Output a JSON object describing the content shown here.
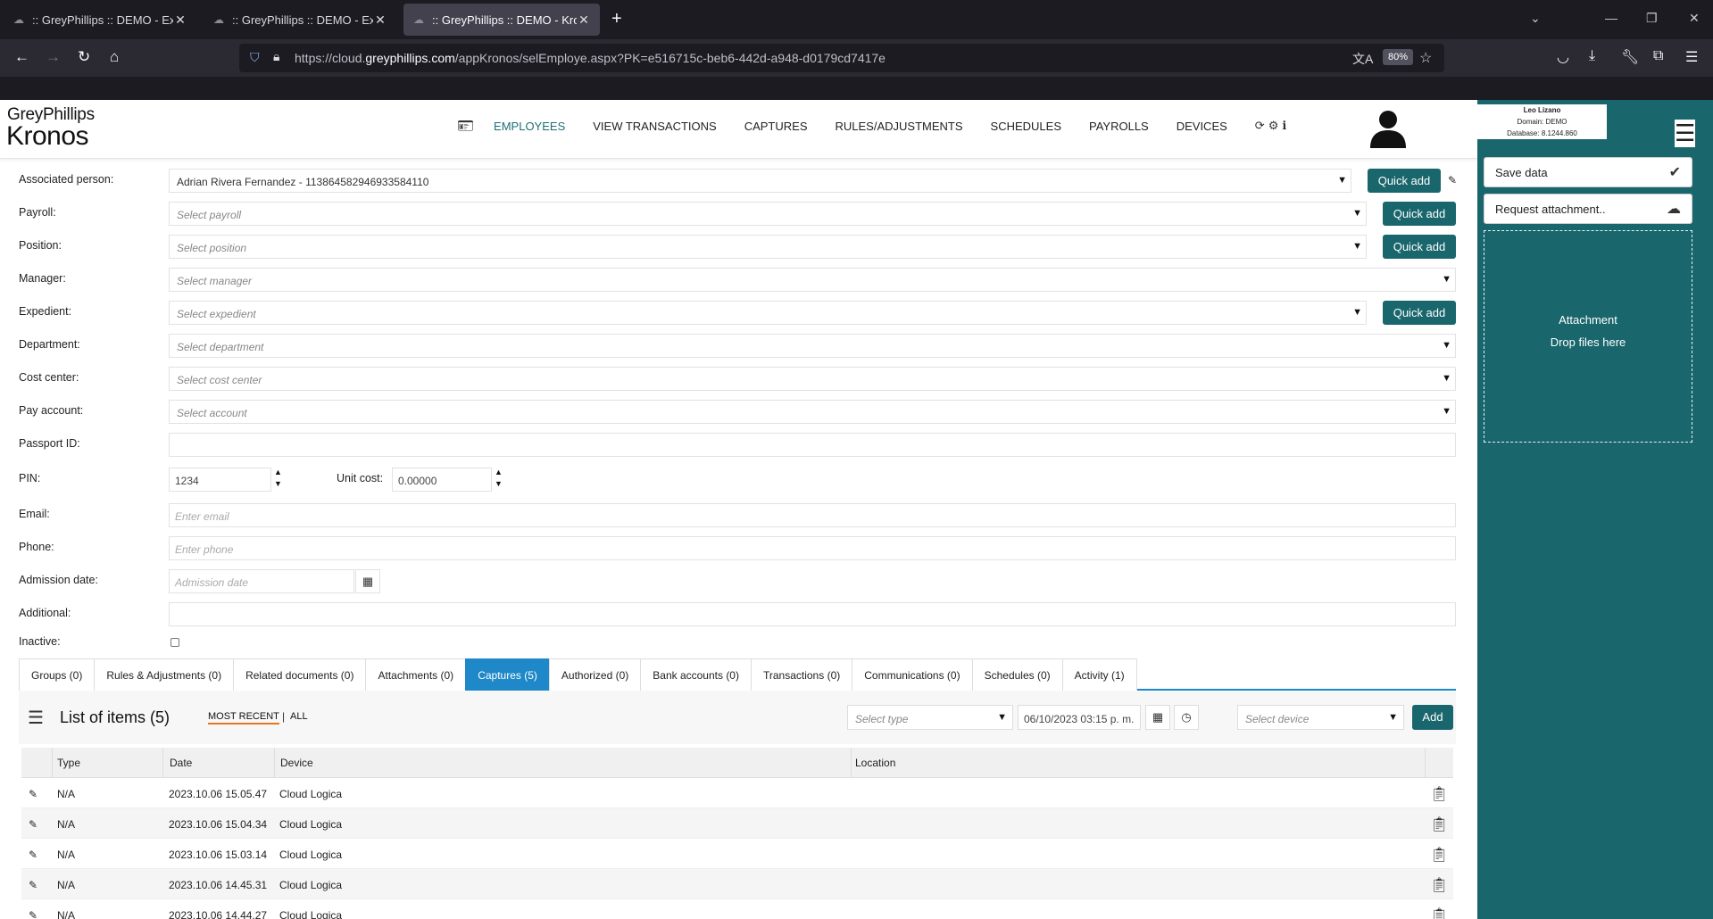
{
  "browser": {
    "tabs": [
      {
        "title": ":: GreyPhillips :: DEMO - Expedie",
        "active": false
      },
      {
        "title": ":: GreyPhillips :: DEMO - Expedie",
        "active": false
      },
      {
        "title": ":: GreyPhillips :: DEMO - Kronos",
        "active": true
      }
    ],
    "url_prefix": "https://cloud.",
    "url_domain": "greyphillips.com",
    "url_path": "/appKronos/selEmploye.aspx?PK=e516715c-beb6-442d-a948-d0179cd7417e",
    "zoom": "80%"
  },
  "app": {
    "logo_line1": "GreyPhillips",
    "logo_line2": "Kronos",
    "nav": [
      "EMPLOYEES",
      "VIEW TRANSACTIONS",
      "CAPTURES",
      "RULES/ADJUSTMENTS",
      "SCHEDULES",
      "PAYROLLS",
      "DEVICES"
    ],
    "nav_active": "EMPLOYEES",
    "user": {
      "name": "Leo Lizano",
      "domain": "Domain: DEMO",
      "database": "Database: 8.1244.860"
    }
  },
  "right_panel": {
    "save_label": "Save data",
    "request_label": "Request attachment..",
    "attachment_label": "Attachment",
    "drop_label": "Drop files here"
  },
  "form": {
    "associated_person": {
      "label": "Associated person:",
      "value": "Adrian Rivera Fernandez - 113864582946933584110",
      "quick_add": "Quick add"
    },
    "payroll": {
      "label": "Payroll:",
      "placeholder": "Select payroll",
      "quick_add": "Quick add"
    },
    "position": {
      "label": "Position:",
      "placeholder": "Select position",
      "quick_add": "Quick add"
    },
    "manager": {
      "label": "Manager:",
      "placeholder": "Select manager"
    },
    "expedient": {
      "label": "Expedient:",
      "placeholder": "Select expedient",
      "quick_add": "Quick add"
    },
    "department": {
      "label": "Department:",
      "placeholder": "Select department"
    },
    "cost_center": {
      "label": "Cost center:",
      "placeholder": "Select cost center"
    },
    "pay_account": {
      "label": "Pay account:",
      "placeholder": "Select account"
    },
    "passport": {
      "label": "Passport ID:",
      "value": ""
    },
    "pin": {
      "label": "PIN:",
      "value": "1234"
    },
    "unit_cost": {
      "label": "Unit cost:",
      "value": "0.00000"
    },
    "email": {
      "label": "Email:",
      "placeholder": "Enter email"
    },
    "phone": {
      "label": "Phone:",
      "placeholder": "Enter phone"
    },
    "admission": {
      "label": "Admission date:",
      "placeholder": "Admission date"
    },
    "additional": {
      "label": "Additional:",
      "value": ""
    },
    "inactive": {
      "label": "Inactive:"
    }
  },
  "tabs": [
    {
      "label": "Groups (0)",
      "active": false
    },
    {
      "label": "Rules & Adjustments (0)",
      "active": false
    },
    {
      "label": "Related documents (0)",
      "active": false
    },
    {
      "label": "Attachments (0)",
      "active": false
    },
    {
      "label": "Captures (5)",
      "active": true
    },
    {
      "label": "Authorized (0)",
      "active": false
    },
    {
      "label": "Bank accounts (0)",
      "active": false
    },
    {
      "label": "Transactions (0)",
      "active": false
    },
    {
      "label": "Communications (0)",
      "active": false
    },
    {
      "label": "Schedules (0)",
      "active": false
    },
    {
      "label": "Activity (1)",
      "active": false
    }
  ],
  "list": {
    "title": "List of items (5)",
    "filter_recent": "MOST RECENT",
    "filter_sep": "|",
    "filter_all": "ALL",
    "type_placeholder": "Select type",
    "date_value": "06/10/2023 03:15 p. m.",
    "device_placeholder": "Select device",
    "add_label": "Add",
    "columns": [
      "Type",
      "Date",
      "Device",
      "Location"
    ],
    "rows": [
      {
        "type": "N/A",
        "date": "2023.10.06 15.05.47",
        "device": "Cloud Logica",
        "location": ""
      },
      {
        "type": "N/A",
        "date": "2023.10.06 15.04.34",
        "device": "Cloud Logica",
        "location": ""
      },
      {
        "type": "N/A",
        "date": "2023.10.06 15.03.14",
        "device": "Cloud Logica",
        "location": ""
      },
      {
        "type": "N/A",
        "date": "2023.10.06 14.45.31",
        "device": "Cloud Logica",
        "location": ""
      },
      {
        "type": "N/A",
        "date": "2023.10.06 14.44.27",
        "device": "Cloud Logica",
        "location": ""
      }
    ]
  },
  "colors": {
    "accent": "#1a666d",
    "tab_active": "#1e88c8",
    "browser_bg": "#1c1b22"
  }
}
